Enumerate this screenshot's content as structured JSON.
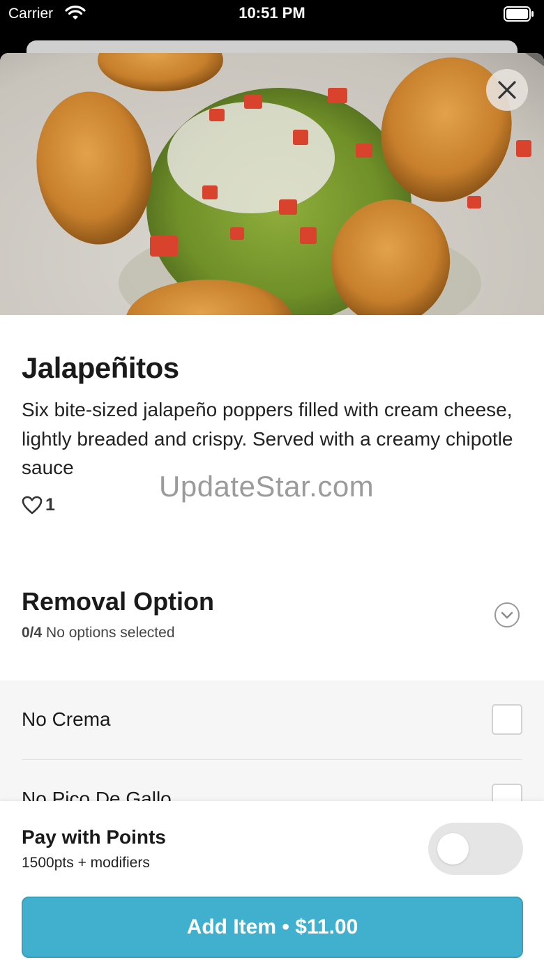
{
  "status_bar": {
    "carrier": "Carrier",
    "time": "10:51 PM"
  },
  "item": {
    "name": "Jalapeñitos",
    "description": "Six bite-sized jalapeño poppers filled with cream cheese, lightly breaded and crispy. Served with a creamy chipotle sauce",
    "likes": "1"
  },
  "watermark": "UpdateStar.com",
  "removal_section": {
    "title": "Removal Option",
    "count": "0/4",
    "status": "No options selected",
    "options": [
      {
        "label": "No Crema"
      },
      {
        "label": "No Pico De Gallo"
      }
    ]
  },
  "points": {
    "title": "Pay with Points",
    "subtitle": "1500pts + modifiers",
    "enabled": false
  },
  "add_button": {
    "label": "Add Item • $11.00"
  },
  "icons": [
    "wifi-icon",
    "battery-icon",
    "close-icon",
    "heart-icon",
    "chevron-down-icon"
  ],
  "colors": {
    "accent": "#41b0cf",
    "toggle_off": "#e5e5e5",
    "options_bg": "#f6f6f6"
  }
}
